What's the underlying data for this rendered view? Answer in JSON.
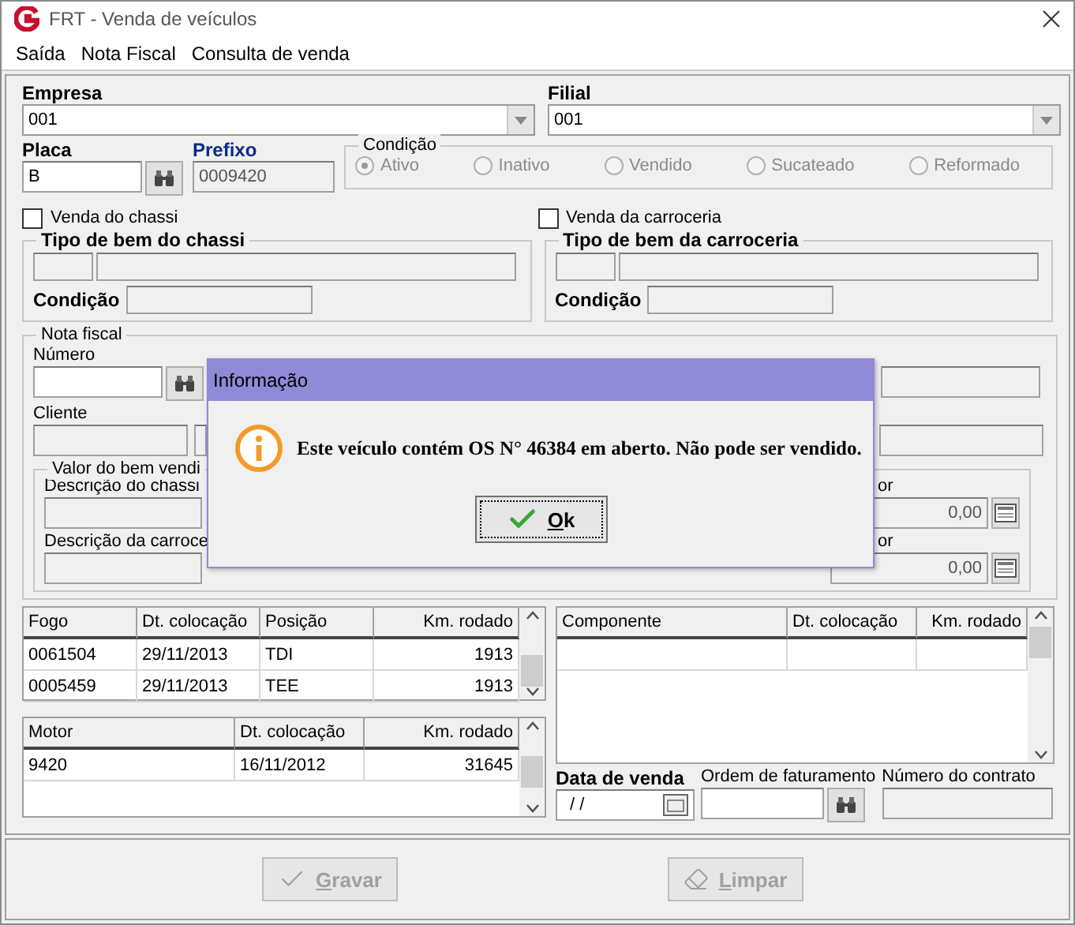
{
  "window": {
    "title": "FRT - Venda de veículos"
  },
  "menu": [
    "Saída",
    "Nota Fiscal",
    "Consulta de venda"
  ],
  "empresa": {
    "label": "Empresa",
    "value": "001"
  },
  "filial": {
    "label": "Filial",
    "value": "001"
  },
  "placa": {
    "label": "Placa",
    "value": "B"
  },
  "prefixo": {
    "label": "Prefixo",
    "value": "0009420"
  },
  "condicao": {
    "label": "Condição",
    "options": [
      {
        "label": "Ativo",
        "selected": true
      },
      {
        "label": "Inativo",
        "selected": false
      },
      {
        "label": "Vendido",
        "selected": false
      },
      {
        "label": "Sucateado",
        "selected": false
      },
      {
        "label": "Reformado",
        "selected": false
      }
    ]
  },
  "checks": [
    {
      "label": "Venda do chassi",
      "checked": false
    },
    {
      "label": "Venda da carroceria",
      "checked": false
    }
  ],
  "tipo_groups": [
    {
      "title": "Tipo de bem do chassi",
      "condition_label": "Condição"
    },
    {
      "title": "Tipo de bem da carroceria",
      "condition_label": "Condição"
    }
  ],
  "nota_fiscal": {
    "title": "Nota fiscal",
    "numero_label": "Número",
    "cliente_label": "Cliente",
    "valor_group": {
      "title": "Valor do bem vendi",
      "rows": [
        {
          "label": "Descrição do chassi",
          "value_label": "or",
          "value": "0,00"
        },
        {
          "label": "Descrição da carroce",
          "value_label": "or",
          "value": "0,00"
        }
      ]
    }
  },
  "tires": {
    "columns": [
      "Fogo",
      "Dt. colocação",
      "Posição",
      "Km. rodado"
    ],
    "rows": [
      [
        "0061504",
        "29/11/2013",
        "TDI",
        "1913"
      ],
      [
        "0005459",
        "29/11/2013",
        "TEE",
        "1913"
      ]
    ]
  },
  "motor": {
    "columns": [
      "Motor",
      "Dt. colocação",
      "Km. rodado"
    ],
    "rows": [
      [
        "9420",
        "16/11/2012",
        "31645"
      ]
    ]
  },
  "components": {
    "columns": [
      "Componente",
      "Dt. colocação",
      "Km. rodado"
    ]
  },
  "data_venda": {
    "label": "Data de venda",
    "value": "/ /"
  },
  "ordem": {
    "label": "Ordem de faturamento"
  },
  "contrato": {
    "label": "Número do contrato"
  },
  "buttons": [
    {
      "label": "Gravar",
      "disabled": true,
      "kind": "save"
    },
    {
      "label": "Limpar",
      "disabled": true,
      "kind": "clear"
    }
  ],
  "dialog": {
    "title": "Informação",
    "message": "Este veículo contém OS N° 46384 em aberto. Não pode ser vendido.",
    "button": "Ok"
  }
}
